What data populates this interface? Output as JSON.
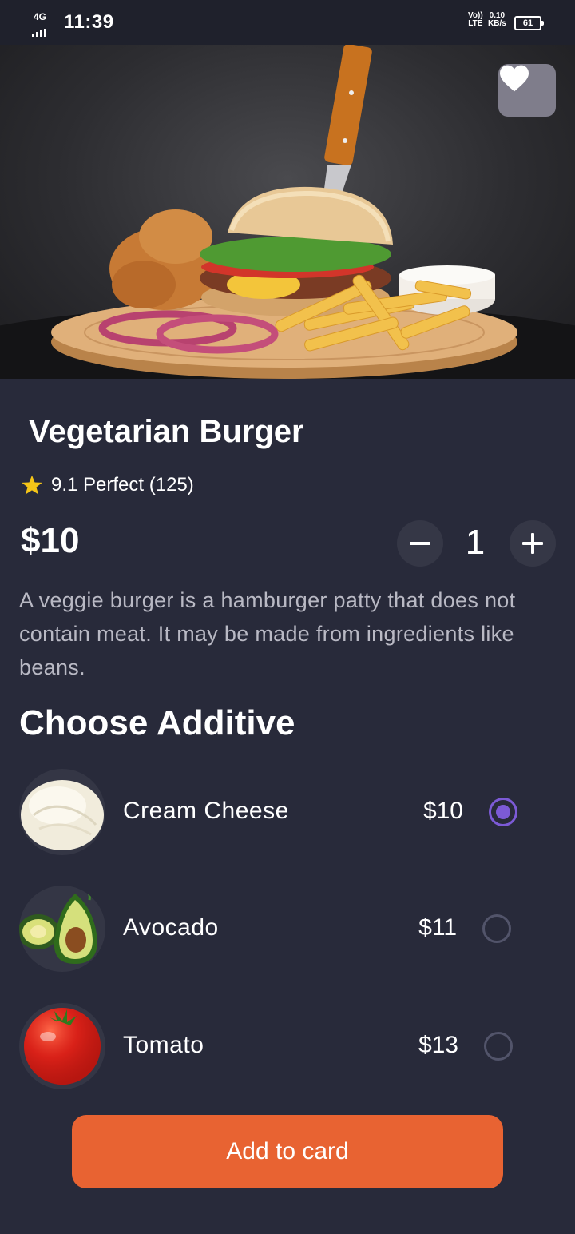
{
  "status_bar": {
    "network": "4G",
    "time": "11:39",
    "volte_top": "Vo))",
    "volte_bottom": "LTE",
    "speed_value": "0.10",
    "speed_unit": "KB/s",
    "battery": "61"
  },
  "product": {
    "title": "Vegetarian Burger",
    "rating_text": "9.1 Perfect (125)",
    "price": "$10",
    "quantity": "1",
    "description": "A veggie burger is a hamburger patty that does not contain meat. It may be made from ingredients like beans.",
    "favorite_icon": "heart-icon",
    "star_icon": "star-icon"
  },
  "additives": {
    "title": "Choose Additive",
    "items": [
      {
        "name": "Cream Cheese",
        "price": "$10",
        "selected": true
      },
      {
        "name": "Avocado",
        "price": "$11",
        "selected": false
      },
      {
        "name": "Tomato",
        "price": "$13",
        "selected": false
      }
    ]
  },
  "cta": {
    "label": "Add to card"
  },
  "colors": {
    "background": "#282a3a",
    "accent": "#e86332",
    "radio_selected": "#7c5ad6"
  }
}
